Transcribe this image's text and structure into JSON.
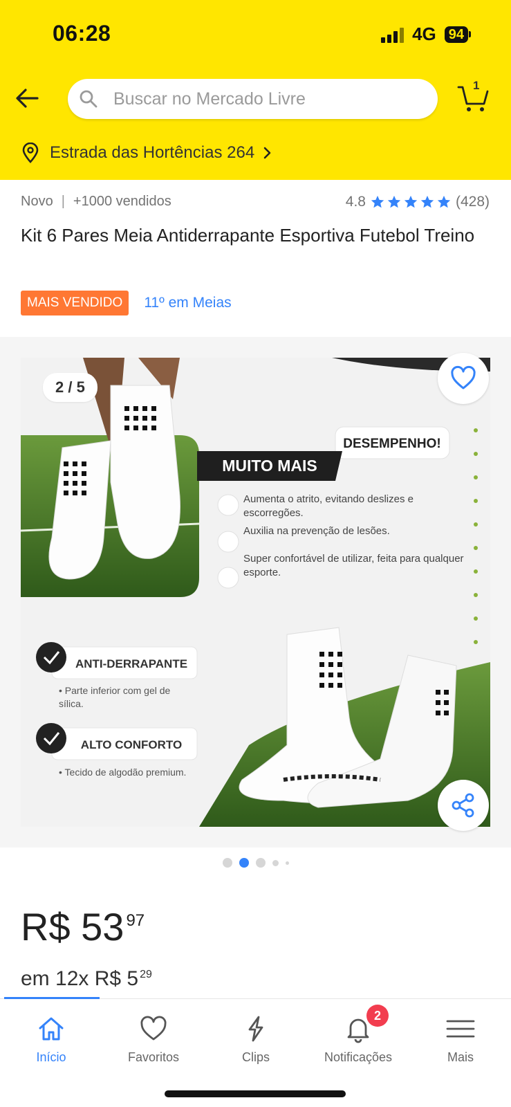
{
  "status_bar": {
    "time": "06:28",
    "network": "4G",
    "battery": "94"
  },
  "header": {
    "search_placeholder": "Buscar no Mercado Livre",
    "cart_count": "1",
    "address": "Estrada das Hortências 264"
  },
  "product": {
    "condition": "Novo",
    "separator": "|",
    "sold": "+1000 vendidos",
    "rating_value": "4.8",
    "rating_count": "(428)",
    "stars": 5,
    "title": "Kit 6 Pares Meia  Antiderrapante Esportiva Futebol Treino",
    "badge": "MAIS VENDIDO",
    "rank": "11º em Meias"
  },
  "gallery": {
    "counter": "2 / 5",
    "current_index": 2,
    "total": 5,
    "image_texts": {
      "performance_top": "DESEMPENHO!",
      "performance_main": "MUITO MAIS",
      "benefit_1": "Aumenta o atrito, evitando deslizes e escorregões.",
      "benefit_2": "Auxilia na prevenção de lesões.",
      "benefit_3": "Super confortável de utilizar, feita para qualquer esporte.",
      "feature_1_title": "ANTI-DERRAPANTE",
      "feature_1_desc": "Parte inferior com gel de sílica.",
      "feature_2_title": "ALTO CONFORTO",
      "feature_2_desc": "Tecido de algodão premium."
    }
  },
  "price": {
    "currency": "R$",
    "main": "R$ 53",
    "cents": "97",
    "installments_main": "em 12x R$ 5",
    "installments_cents": "29"
  },
  "tabs": [
    {
      "label": "Início",
      "icon": "home-icon",
      "active": true
    },
    {
      "label": "Favoritos",
      "icon": "heart-icon",
      "active": false
    },
    {
      "label": "Clips",
      "icon": "clips-icon",
      "active": false
    },
    {
      "label": "Notificações",
      "icon": "bell-icon",
      "active": false,
      "badge": "2"
    },
    {
      "label": "Mais",
      "icon": "menu-icon",
      "active": false
    }
  ],
  "colors": {
    "brand_yellow": "#ffe600",
    "accent_blue": "#3483fa",
    "badge_orange": "#ff7733",
    "notif_red": "#f23d4f"
  }
}
